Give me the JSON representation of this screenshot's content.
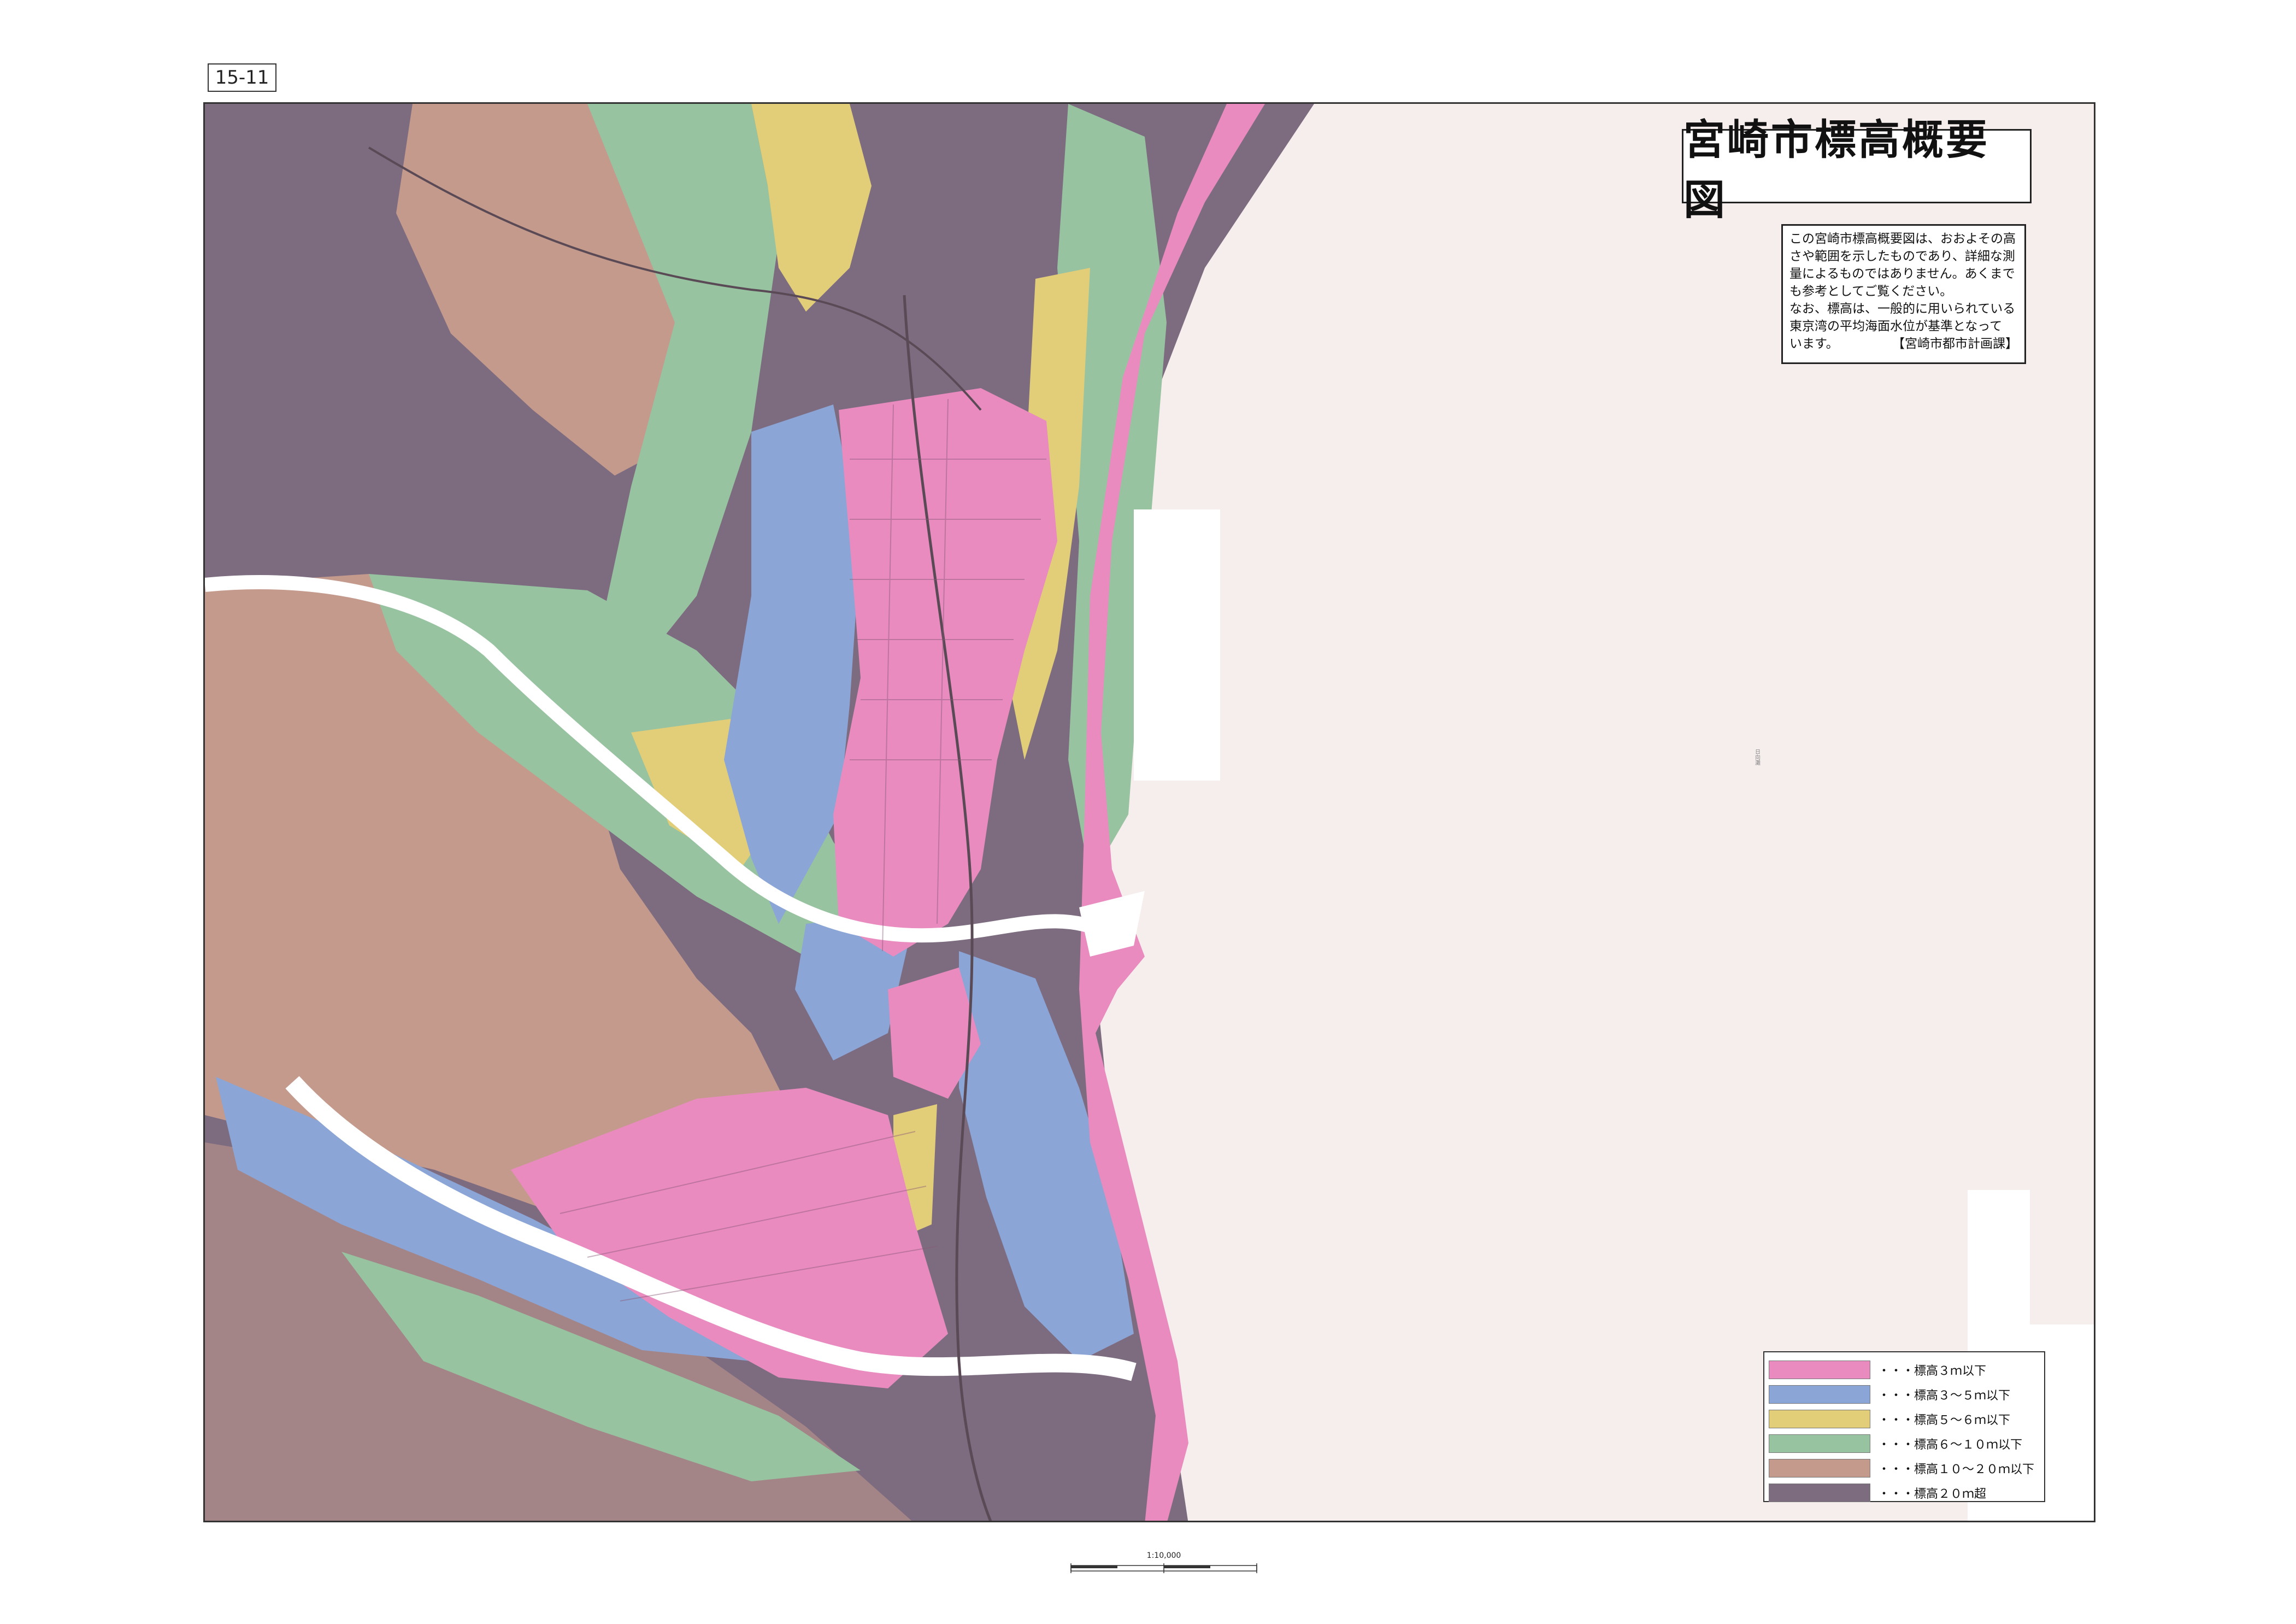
{
  "sheet_id": "15-11",
  "title": "宮崎市標高概要図",
  "note": {
    "lines": [
      "この宮崎市標高概要図は、おおよその高",
      "さや範囲を示したものであり、詳細な測",
      "量によるものではありません。あくまで",
      "も参考としてご覧ください。",
      "なお、標高は、一般的に用いられている",
      "東京湾の平均海面水位が基準となって",
      "います。"
    ],
    "department": "【宮崎市都市計画課】"
  },
  "legend": {
    "items": [
      {
        "label": "・・・標高３ｍ以下",
        "color": "#e98bbf"
      },
      {
        "label": "・・・標高３～５ｍ以下",
        "color": "#8aa5d6"
      },
      {
        "label": "・・・標高５～６ｍ以下",
        "color": "#e2cd79"
      },
      {
        "label": "・・・標高６～１０ｍ以下",
        "color": "#97c3a0"
      },
      {
        "label": "・・・標高１０～２０ｍ以下",
        "color": "#c49a8c"
      },
      {
        "label": "・・・標高２０ｍ超",
        "color": "#7d6c80"
      }
    ]
  },
  "scale": {
    "label": "1:10,000"
  },
  "sea_labels": [
    "日向灘"
  ],
  "colors": {
    "sea": "#f6eded",
    "river": "#ffffff",
    "road": "#5a4a55",
    "border": "#333333"
  }
}
